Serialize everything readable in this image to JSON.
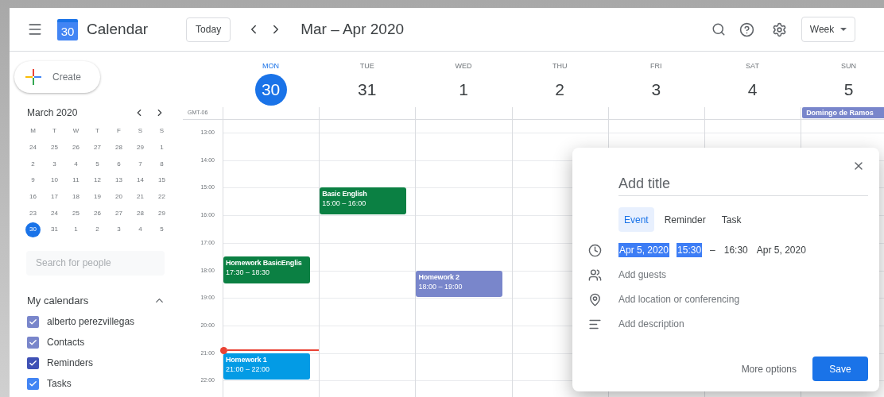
{
  "app": {
    "logo_text": "30",
    "name": "Calendar"
  },
  "toolbar": {
    "today_button": "Today",
    "range_title": "Mar – Apr 2020",
    "view_select": "Week"
  },
  "create_button": "Create",
  "mini_calendar": {
    "title": "March 2020",
    "weekdays": [
      "M",
      "T",
      "W",
      "T",
      "F",
      "S",
      "S"
    ],
    "weeks": [
      [
        {
          "label": "24",
          "selected": false
        },
        {
          "label": "25",
          "selected": false
        },
        {
          "label": "26",
          "selected": false
        },
        {
          "label": "27",
          "selected": false
        },
        {
          "label": "28",
          "selected": false
        },
        {
          "label": "29",
          "selected": false
        },
        {
          "label": "1",
          "selected": false
        }
      ],
      [
        {
          "label": "2",
          "selected": false
        },
        {
          "label": "3",
          "selected": false
        },
        {
          "label": "4",
          "selected": false
        },
        {
          "label": "5",
          "selected": false
        },
        {
          "label": "6",
          "selected": false
        },
        {
          "label": "7",
          "selected": false
        },
        {
          "label": "8",
          "selected": false
        }
      ],
      [
        {
          "label": "9",
          "selected": false
        },
        {
          "label": "10",
          "selected": false
        },
        {
          "label": "11",
          "selected": false
        },
        {
          "label": "12",
          "selected": false
        },
        {
          "label": "13",
          "selected": false
        },
        {
          "label": "14",
          "selected": false
        },
        {
          "label": "15",
          "selected": false
        }
      ],
      [
        {
          "label": "16",
          "selected": false
        },
        {
          "label": "17",
          "selected": false
        },
        {
          "label": "18",
          "selected": false
        },
        {
          "label": "19",
          "selected": false
        },
        {
          "label": "20",
          "selected": false
        },
        {
          "label": "21",
          "selected": false
        },
        {
          "label": "22",
          "selected": false
        }
      ],
      [
        {
          "label": "23",
          "selected": false
        },
        {
          "label": "24",
          "selected": false
        },
        {
          "label": "25",
          "selected": false
        },
        {
          "label": "26",
          "selected": false
        },
        {
          "label": "27",
          "selected": false
        },
        {
          "label": "28",
          "selected": false
        },
        {
          "label": "29",
          "selected": false
        }
      ],
      [
        {
          "label": "30",
          "selected": true
        },
        {
          "label": "31",
          "selected": false
        },
        {
          "label": "1",
          "selected": false
        },
        {
          "label": "2",
          "selected": false
        },
        {
          "label": "3",
          "selected": false
        },
        {
          "label": "4",
          "selected": false
        },
        {
          "label": "5",
          "selected": false
        }
      ]
    ]
  },
  "people_search": {
    "placeholder": "Search for people"
  },
  "my_calendars": {
    "title": "My calendars",
    "expanded": true,
    "items": [
      {
        "label": "alberto perezvillegas",
        "checked": true,
        "color": "#7986cb"
      },
      {
        "label": "Contacts",
        "checked": true,
        "color": "#7986cb"
      },
      {
        "label": "Reminders",
        "checked": true,
        "color": "#3f51b5"
      },
      {
        "label": "Tasks",
        "checked": true,
        "color": "#4285f4"
      }
    ]
  },
  "timezone": "GMT-06",
  "hours": [
    "13:00",
    "14:00",
    "15:00",
    "16:00",
    "17:00",
    "18:00",
    "19:00",
    "20:00",
    "21:00",
    "22:00"
  ],
  "days": [
    {
      "weekday": "MON",
      "date": "30",
      "selected": true,
      "now_marker": true,
      "events": [
        {
          "title": "Homework BasicEnglis",
          "time": "17:30 – 18:30",
          "color": "#0b8043"
        },
        {
          "title": "Homework 1",
          "time": "21:00 – 22:00",
          "color": "#039be5"
        }
      ]
    },
    {
      "weekday": "TUE",
      "date": "31",
      "selected": false,
      "events": [
        {
          "title": "Basic English",
          "time": "15:00 – 16:00",
          "color": "#0b8043"
        }
      ]
    },
    {
      "weekday": "WED",
      "date": "1",
      "selected": false,
      "events": [
        {
          "title": "Homework 2",
          "time": "18:00 – 19:00",
          "color": "#7986cb"
        }
      ]
    },
    {
      "weekday": "THU",
      "date": "2",
      "selected": false
    },
    {
      "weekday": "FRI",
      "date": "3",
      "selected": false
    },
    {
      "weekday": "SAT",
      "date": "4",
      "selected": false
    },
    {
      "weekday": "SUN",
      "date": "5",
      "selected": false,
      "all_day": [
        {
          "title": "Domingo de Ramos",
          "color": "#7986cb"
        }
      ]
    }
  ],
  "dialog": {
    "title_placeholder": "Add title",
    "tabs": [
      {
        "label": "Event",
        "selected": true
      },
      {
        "label": "Reminder",
        "selected": false
      },
      {
        "label": "Task",
        "selected": false
      }
    ],
    "when": [
      {
        "text": "Apr 5, 2020",
        "highlighted": true
      },
      {
        "text": "15:30",
        "highlighted": true
      },
      {
        "text": "–",
        "highlighted": false
      },
      {
        "text": "16:30",
        "highlighted": false
      },
      {
        "text": "Apr 5, 2020",
        "highlighted": false
      }
    ],
    "rows": [
      {
        "kind": "guests",
        "label": "Add guests"
      },
      {
        "kind": "location",
        "label": "Add location or conferencing"
      },
      {
        "kind": "description",
        "label": "Add description"
      }
    ],
    "more_options": "More options",
    "save": "Save"
  }
}
